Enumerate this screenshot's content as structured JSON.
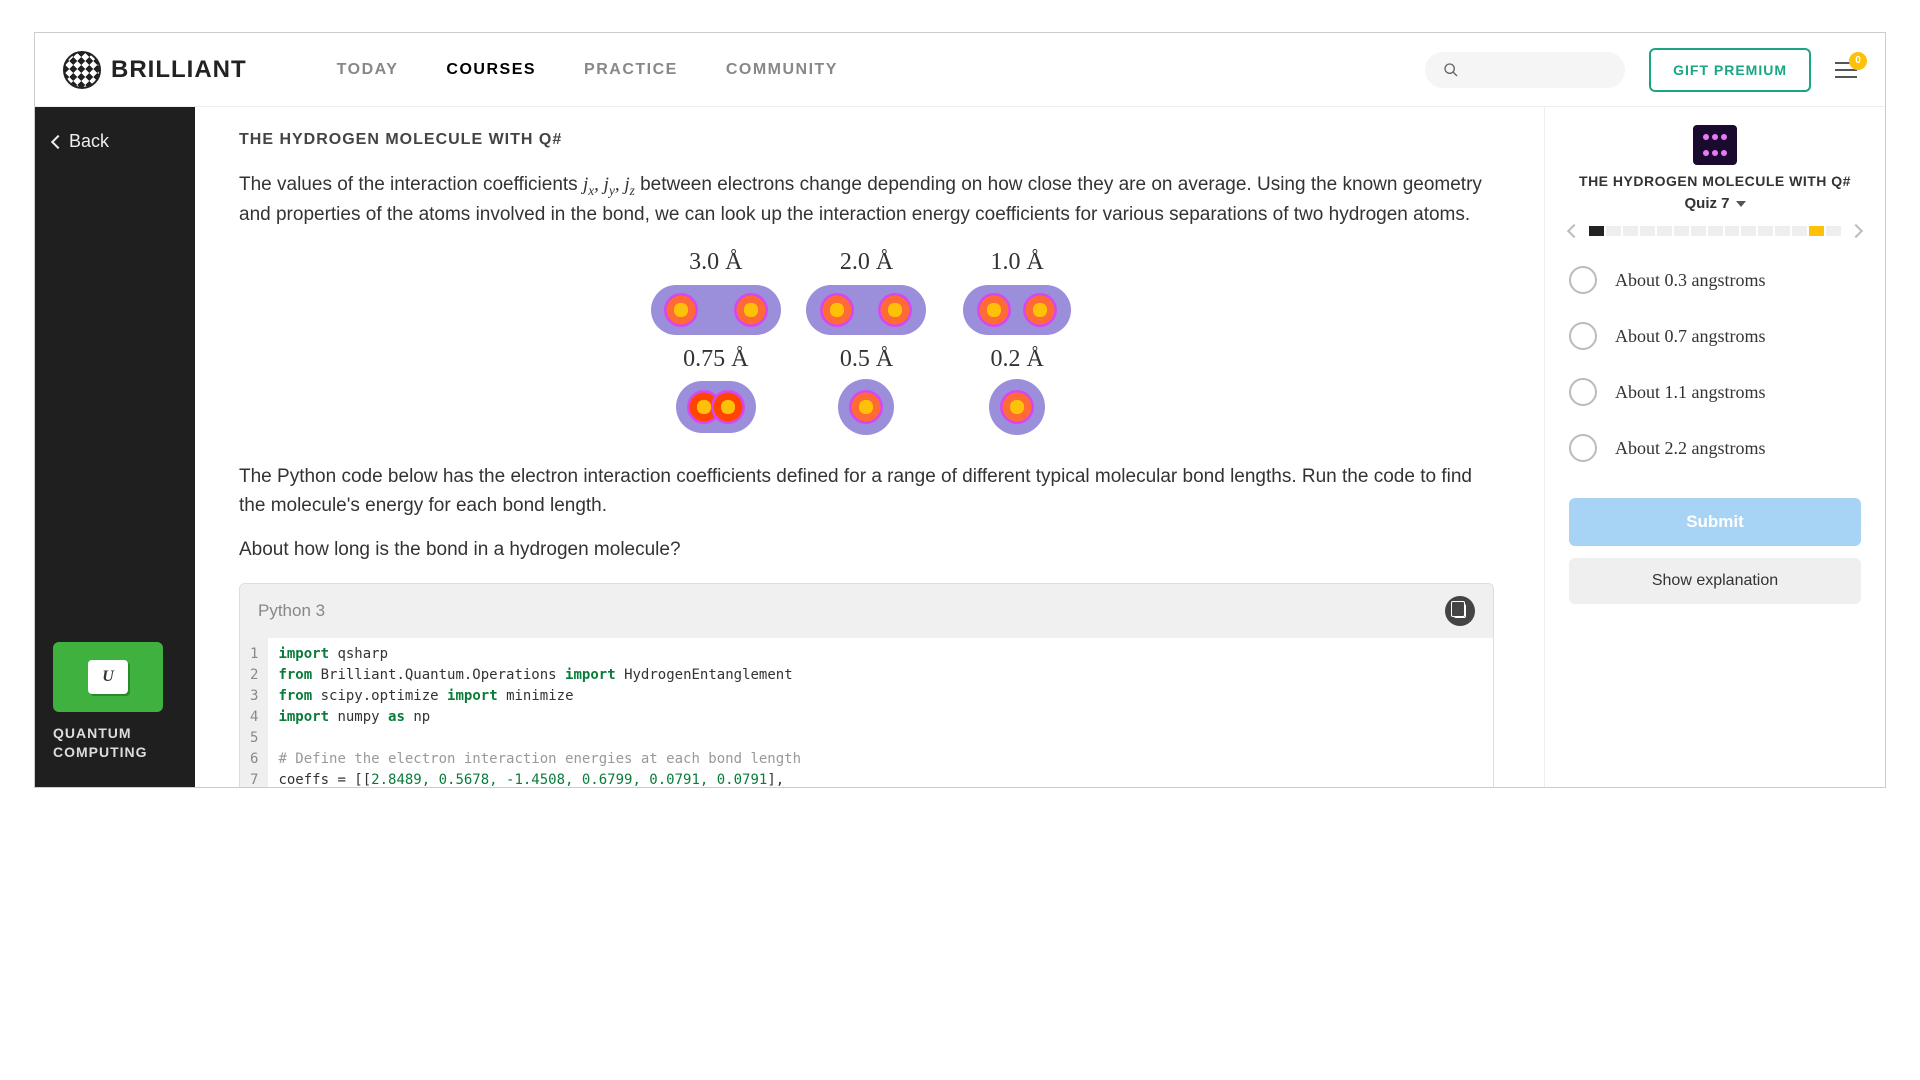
{
  "nav": {
    "brand": "BRILLIANT",
    "links": [
      "TODAY",
      "COURSES",
      "PRACTICE",
      "COMMUNITY"
    ],
    "active_index": 1,
    "gift_label": "GIFT PREMIUM",
    "badge_count": "0"
  },
  "sidebar": {
    "back_label": "Back",
    "course_glyph": "U",
    "course_label_line1": "QUANTUM",
    "course_label_line2": "COMPUTING"
  },
  "lesson": {
    "title": "THE HYDROGEN MOLECULE WITH Q#",
    "para1_pre": "The values of the interaction coefficients ",
    "para1_math": "j<sub>x</sub>, j<sub>y</sub>, j<sub>z</sub>",
    "para1_post": " between electrons change depending on how close they are on average. Using the known geometry and properties of the atoms involved in the bond, we can look up the interaction energy coefficients for various separations of two hydrogen atoms.",
    "molecules": [
      "3.0 Å",
      "2.0 Å",
      "1.0 Å",
      "0.75 Å",
      "0.5 Å",
      "0.2 Å"
    ],
    "para2": "The Python code below has the electron interaction coefficients defined for a range of different typical molecular bond lengths. Run the code to find the molecule's energy for each bond length.",
    "question": "About how long is the bond in a hydrogen molecule?",
    "code_lang": "Python 3",
    "code_lines": [
      {
        "n": "1",
        "html": "<span class='kw'>import</span> <span class='id'>qsharp</span>"
      },
      {
        "n": "2",
        "html": "<span class='kw'>from</span> <span class='id'>Brilliant.Quantum.Operations</span> <span class='kw'>import</span> <span class='id'>HydrogenEntanglement</span>"
      },
      {
        "n": "3",
        "html": "<span class='kw'>from</span> <span class='id'>scipy.optimize</span> <span class='kw'>import</span> <span class='id'>minimize</span>"
      },
      {
        "n": "4",
        "html": "<span class='kw'>import</span> <span class='id'>numpy</span> <span class='kw'>as</span> <span class='id'>np</span>"
      },
      {
        "n": "5",
        "html": ""
      },
      {
        "n": "6",
        "html": "<span class='cm'># Define the electron interaction energies at each bond length</span>"
      },
      {
        "n": "7",
        "html": "<span class='id'>coeffs = [[</span><span class='num'>2.8489, 0.5678, -1.4508, 0.6799, 0.0791, 0.0791</span><span class='id'>],</span>"
      }
    ]
  },
  "quiz": {
    "title": "THE HYDROGEN MOLECULE WITH Q#",
    "subtitle": "Quiz 7",
    "progress_total": 15,
    "progress_done": [
      0
    ],
    "progress_current": 13,
    "options": [
      "About 0.3 angstroms",
      "About 0.7 angstroms",
      "About 1.1 angstroms",
      "About 2.2 angstroms"
    ],
    "submit_label": "Submit",
    "explain_label": "Show explanation"
  }
}
